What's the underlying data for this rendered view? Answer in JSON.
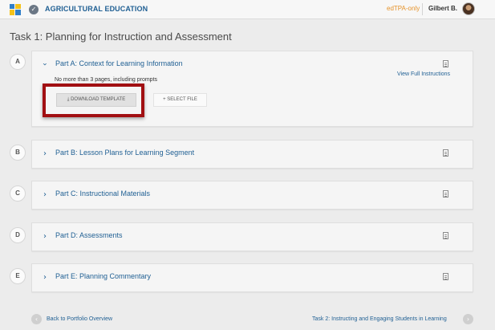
{
  "header": {
    "app_title": "AGRICULTURAL EDUCATION",
    "badge": "edTPA-only",
    "user": "Gilbert B."
  },
  "page": {
    "title": "Task 1: Planning for Instruction and Assessment"
  },
  "parts": [
    {
      "letter": "A",
      "title": "Part A: Context for Learning Information",
      "expanded": true,
      "hint": "No more than 3 pages, including prompts",
      "view_instructions": "View Full Instructions",
      "download_label": "⤓ DOWNLOAD TEMPLATE",
      "select_label": "+ SELECT FILE"
    },
    {
      "letter": "B",
      "title": "Part B: Lesson Plans for Learning Segment",
      "expanded": false
    },
    {
      "letter": "C",
      "title": "Part C: Instructional Materials",
      "expanded": false
    },
    {
      "letter": "D",
      "title": "Part D: Assessments",
      "expanded": false
    },
    {
      "letter": "E",
      "title": "Part E: Planning Commentary",
      "expanded": false
    }
  ],
  "footer": {
    "back_label": "Back to Portfolio Overview",
    "next_label": "Task 2: Instructing and Engaging Students in Learning"
  },
  "colors": {
    "link": "#1f5f93",
    "badge": "#e6932a",
    "highlight": "#a10f12"
  }
}
